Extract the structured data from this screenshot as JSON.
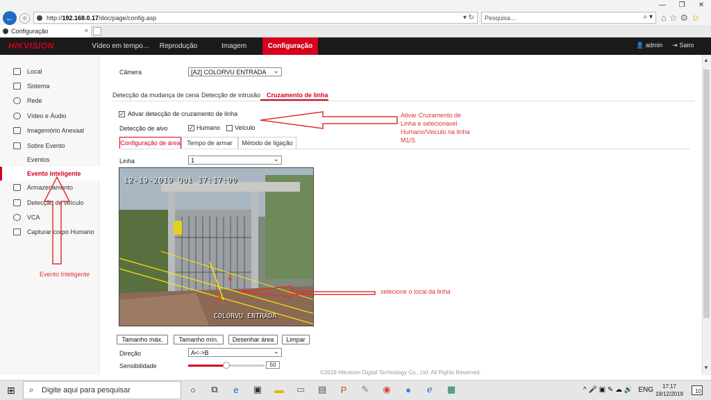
{
  "browser": {
    "url_prefix": "http://",
    "url_host": "192.168.0.17",
    "url_path": "/doc/page/config.asp",
    "search_placeholder": "Pesquisa...",
    "tab_title": "Configuração",
    "tab_close": "×",
    "window_min": "—",
    "window_max": "❐",
    "window_close": "✕",
    "address_tools": "▾ ↻",
    "back_glyph": "←",
    "forward_glyph": "⊕",
    "search_glyph": "⌕ ▾",
    "home_glyph": "⌂",
    "star_glyph": "☆",
    "gear_glyph": "⚙",
    "smile_glyph": "☺"
  },
  "app": {
    "logo": "HIKVISION",
    "nav": {
      "live": "Vídeo em tempo…",
      "playback": "Reprodução",
      "image": "Imagem",
      "config": "Configuração"
    },
    "user": "admin",
    "logout": "Sairo",
    "user_icon_glyph": "👤",
    "logout_icon_glyph": "⇥"
  },
  "sidebar": {
    "items": [
      {
        "label": "Local"
      },
      {
        "label": "Sistema"
      },
      {
        "label": "Rede"
      },
      {
        "label": "Vídeo e Áudio"
      },
      {
        "label": "Imagemório Anexaal"
      },
      {
        "label": "Sobre Evento"
      },
      {
        "label": "Eventos"
      },
      {
        "label": "Evento inteligente"
      },
      {
        "label": "Armazenamento"
      },
      {
        "label": "Detecção de veículo"
      },
      {
        "label": "VCA"
      },
      {
        "label": "Capturar corpo Humano"
      }
    ]
  },
  "main": {
    "camera_label": "Câmera",
    "camera_value": "[A2] COLORVU ENTRADA",
    "tabs": [
      {
        "label": "Detecção da mudança de cena"
      },
      {
        "label": "Detecção de intrusão"
      },
      {
        "label": "Cruzamento de linha"
      }
    ],
    "enable_label": "Ativar detecção de cruzamento de linha",
    "enable_checked": "✓",
    "target_label": "Detecção de alvo",
    "target_human": "Humano",
    "target_human_checked": "✓",
    "target_vehicle": "Veículo",
    "subtabs": [
      {
        "label": "Configuração de área"
      },
      {
        "label": "Tempo de armar"
      },
      {
        "label": "Método de ligação"
      }
    ],
    "line_label": "Linha",
    "line_value": "1",
    "camera_time": "12-19-2019 Qui 17:17:00",
    "camera_name": "COLORVU ENTRADA",
    "camera_point_a": "A",
    "camera_point_b": "B",
    "buttons": {
      "max_size": "Tamanho máx.",
      "min_size": "Tamanho mín.",
      "draw_area": "Desenhar área",
      "clear": "Limpar"
    },
    "direction_label": "Direção",
    "direction_value": "A<->B",
    "sensitivity_label": "Sensibilidade",
    "sensitivity_value": 50,
    "sensitivity_value_text": "50",
    "footer": "©2019 Hikvision Digital Technology Co., Ltd. All Rights Reserved.",
    "chevron": "⌄"
  },
  "annotations": {
    "line_note": "Ativar Cruzamento de Linha e selecionavel Humano/Veiculo na linha M1/S",
    "location_note": "selecione o local da linha",
    "menu_note": "Evento Inteligente"
  },
  "taskbar": {
    "start_glyph": "⊞",
    "search_placeholder": "Digite aqui para pesquisar",
    "search_glyph": "⌕",
    "tray": "^ 🎤 ▣ ✎ ☁ 🔊",
    "language": "ENG",
    "time": "17:17",
    "date": "19/12/2019",
    "notifications": "10"
  },
  "colors": {
    "accent": "#d4001c",
    "header_bg": "#1a1a1a",
    "annotation": "#e03030"
  }
}
